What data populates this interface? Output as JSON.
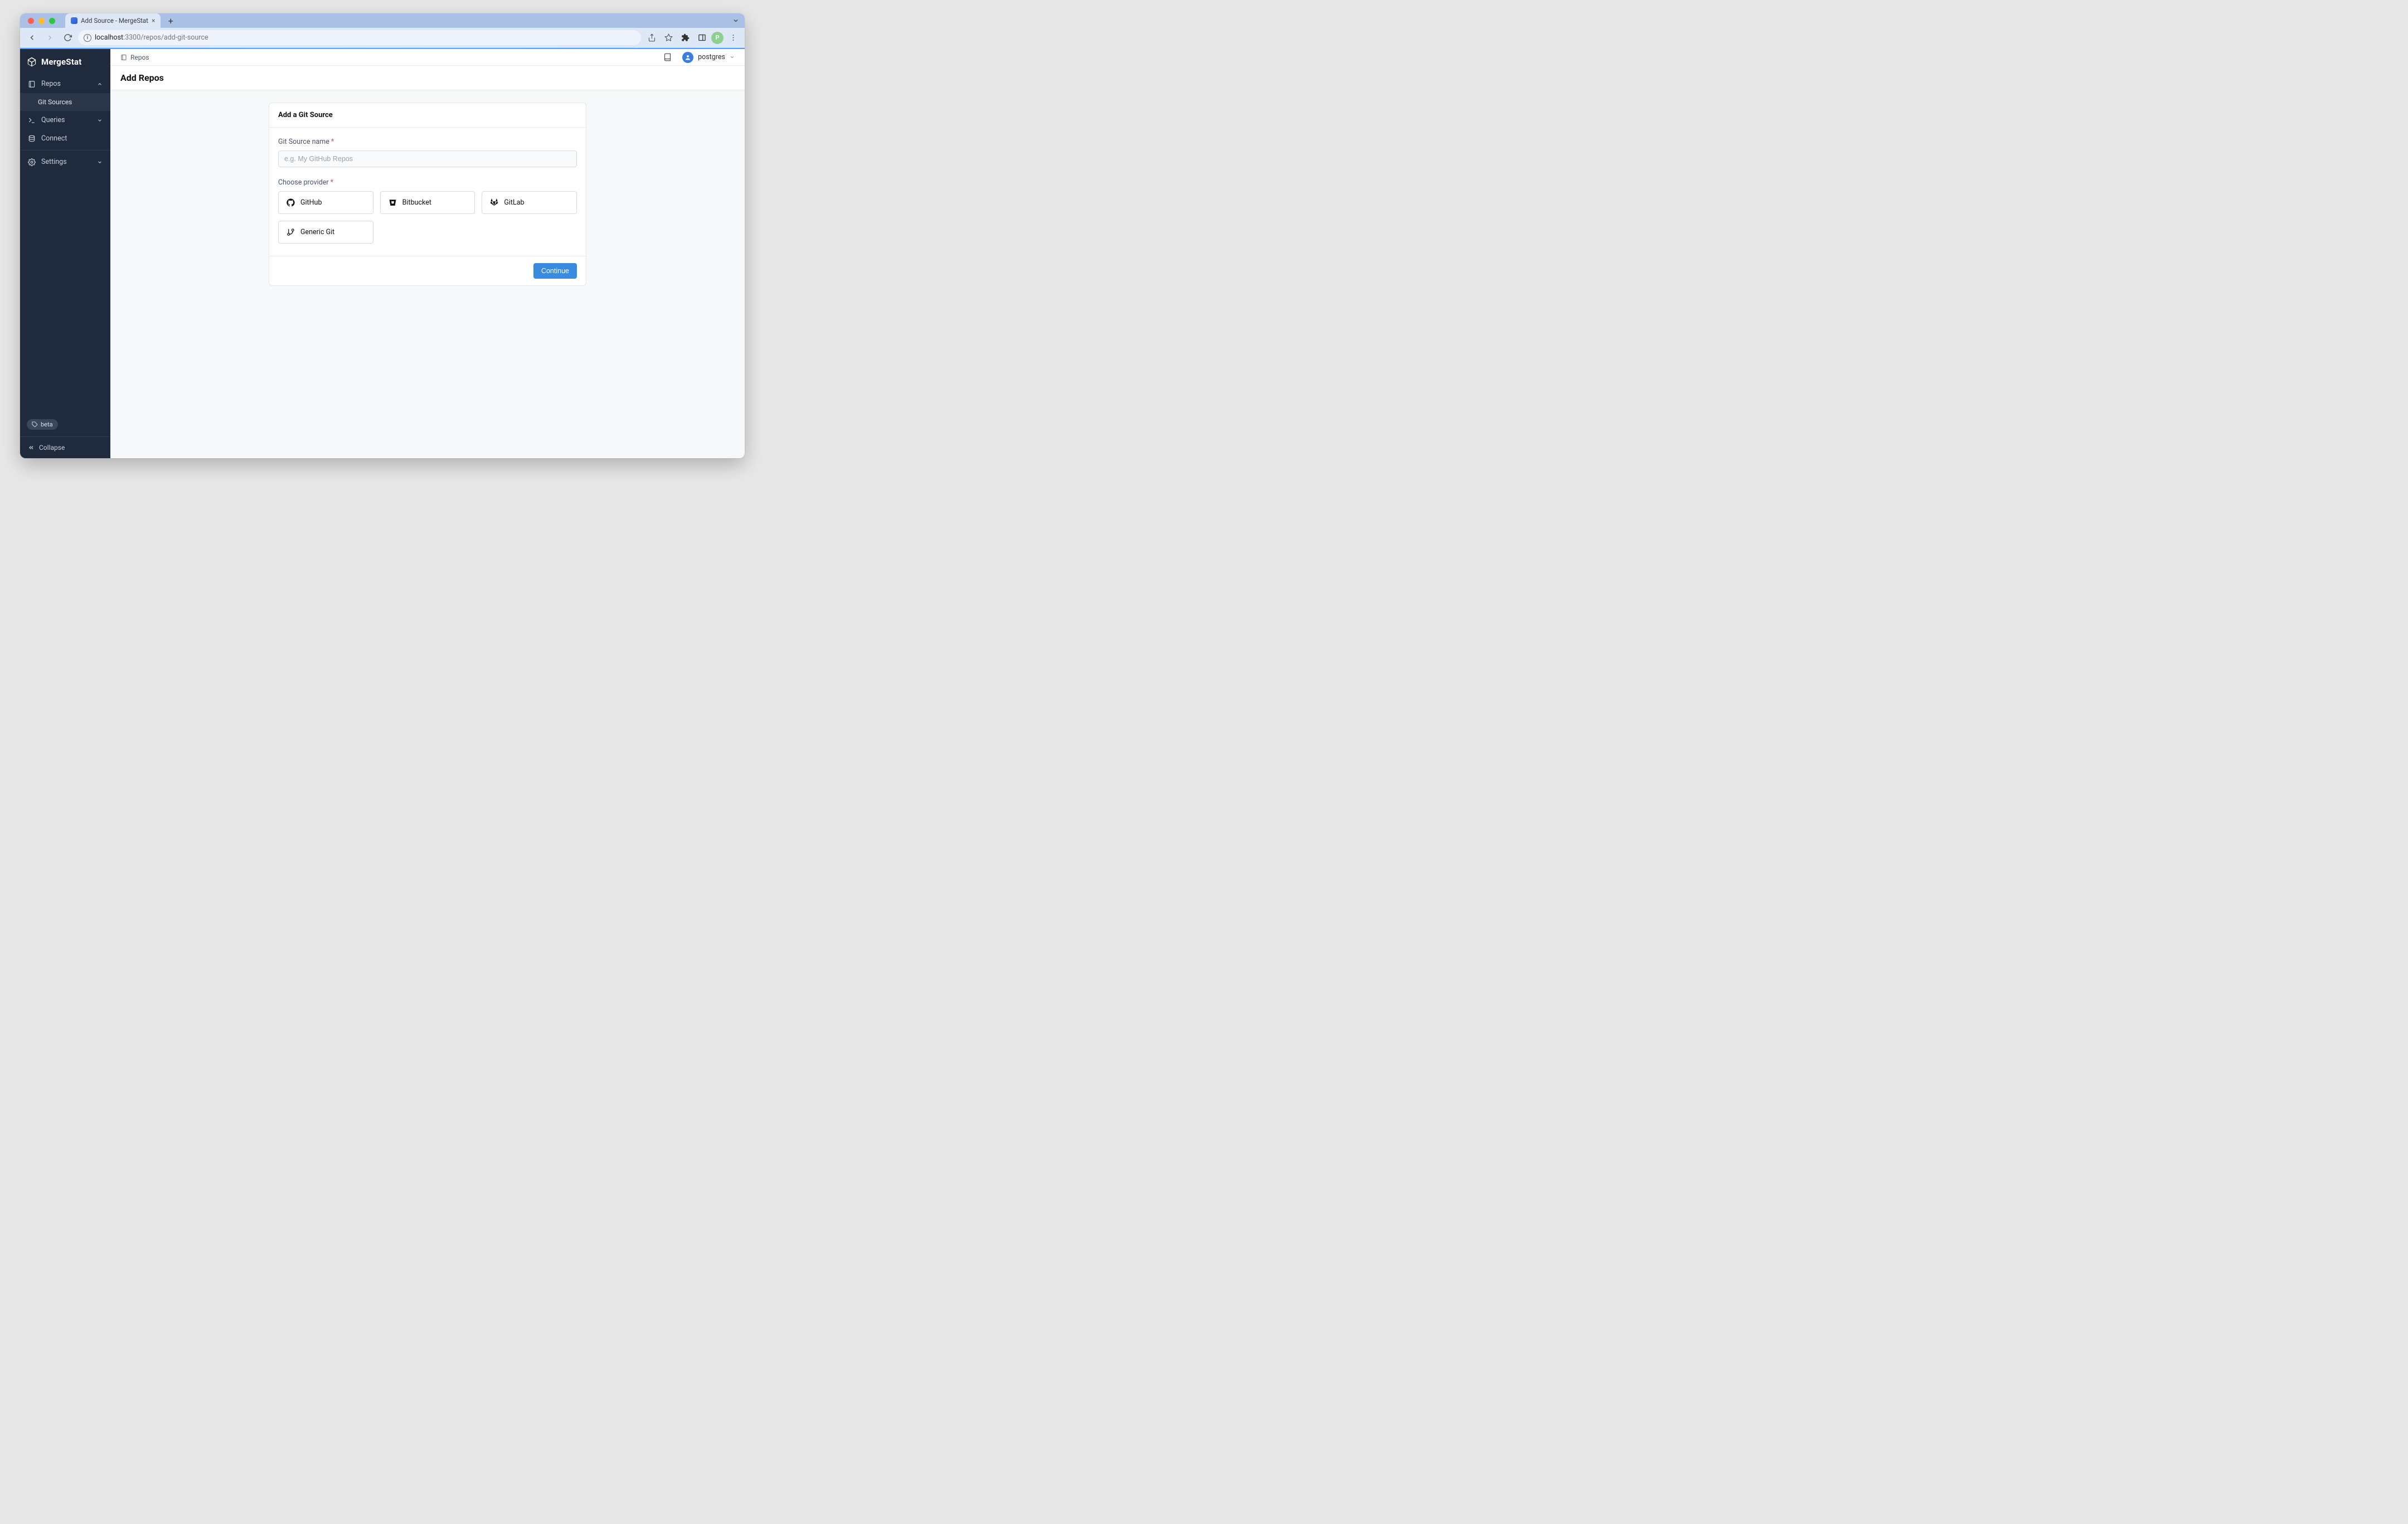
{
  "browser": {
    "tab_title": "Add Source - MergeStat",
    "url_host": "localhost",
    "url_path": ":3300/repos/add-git-source",
    "profile_initial": "P"
  },
  "app": {
    "brand": "MergeStat",
    "sidebar": {
      "repos": "Repos",
      "git_sources": "Git Sources",
      "queries": "Queries",
      "connect": "Connect",
      "settings": "Settings",
      "beta": "beta",
      "collapse": "Collapse"
    },
    "topbar": {
      "breadcrumb": "Repos",
      "user": "postgres"
    },
    "page": {
      "title": "Add Repos"
    },
    "form": {
      "card_title": "Add a Git Source",
      "name_label": "Git Source name",
      "name_placeholder": "e.g. My GitHub Repos",
      "provider_label": "Choose provider",
      "providers": {
        "github": "GitHub",
        "bitbucket": "Bitbucket",
        "gitlab": "GitLab",
        "generic": "Generic Git"
      },
      "continue": "Continue"
    }
  }
}
